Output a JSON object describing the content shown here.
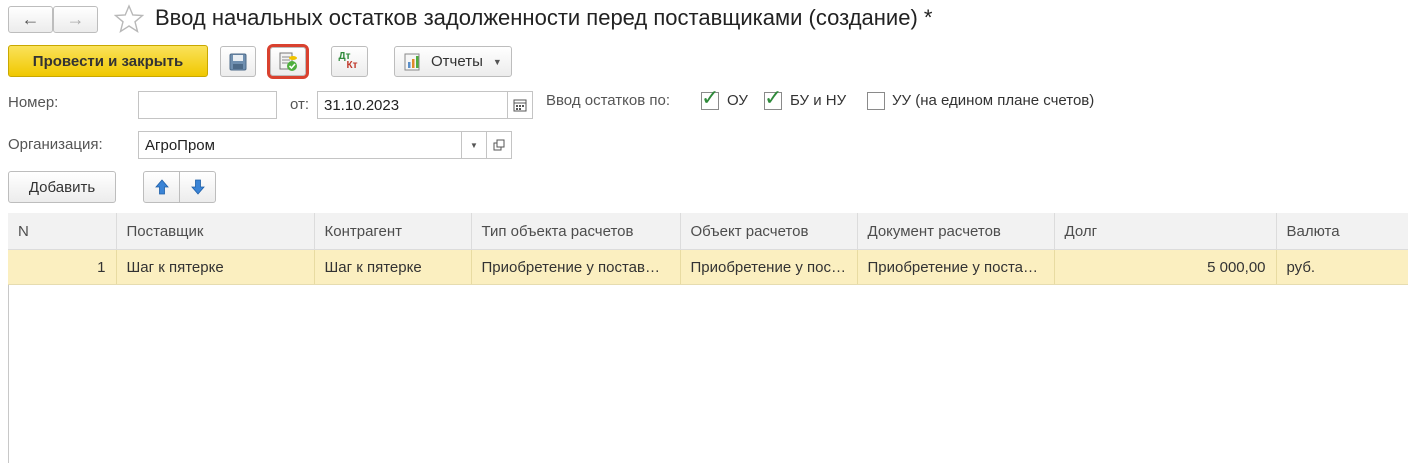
{
  "window": {
    "title": "Ввод начальных остатков задолженности перед поставщиками (создание) *"
  },
  "toolbar": {
    "post_and_close_label": "Провести и закрыть",
    "dt_label": "Дт",
    "kt_label": "Кт",
    "reports_label": "Отчеты"
  },
  "form": {
    "number_label": "Номер:",
    "number_value": "",
    "date_label": "от:",
    "date_value": "31.10.2023",
    "balances_label": "Ввод остатков по:",
    "checkboxes": [
      {
        "label": "ОУ",
        "checked": true
      },
      {
        "label": "БУ и НУ",
        "checked": true
      },
      {
        "label": "УУ (на едином плане счетов)",
        "checked": false
      }
    ],
    "organization_label": "Организация:",
    "organization_value": "АгроПром"
  },
  "table_toolbar": {
    "add_label": "Добавить"
  },
  "table": {
    "columns": [
      "N",
      "Поставщик",
      "Контрагент",
      "Тип объекта расчетов",
      "Объект расчетов",
      "Документ расчетов",
      "Долг",
      "Валюта"
    ],
    "rows": [
      {
        "n": "1",
        "supplier": "Шаг к пятерке",
        "counterparty": "Шаг к пятерке",
        "object_type": "Приобретение у поставщика",
        "object": "Приобретение у поставщика",
        "document": "Приобретение у поставщика",
        "debt": "5 000,00",
        "currency": "руб."
      }
    ]
  },
  "colors": {
    "accent": "#f5d40f",
    "selected_row": "#fbefc0",
    "highlight": "#d9412f"
  }
}
